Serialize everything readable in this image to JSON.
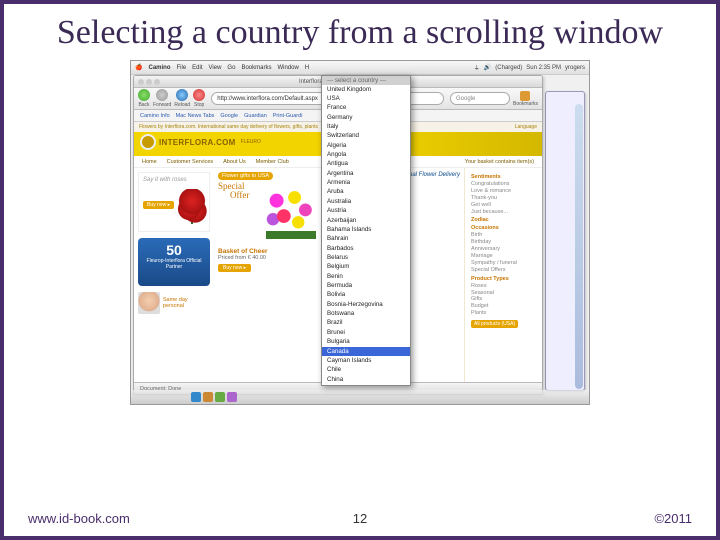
{
  "slide": {
    "title": "Selecting a country from a scrolling window",
    "page_number": "12",
    "footer_url": "www.id-book.com",
    "copyright": "©2011"
  },
  "mac_menubar": {
    "app": "Camino",
    "items": [
      "File",
      "Edit",
      "View",
      "Go",
      "Bookmarks",
      "Window",
      "H"
    ],
    "status_battery": "(Charged)",
    "status_time": "Sun 2:35 PM",
    "status_user": "yrogers"
  },
  "browser": {
    "window_title": "Interflora.com FLOWERS| Int",
    "toolbar": {
      "back": "Back",
      "forward": "Forward",
      "reload": "Reload",
      "stop": "Stop"
    },
    "url": "http://www.interflora.com/Default.aspx",
    "search_placeholder": "Google",
    "bookmarks_btn": "Bookmarks",
    "bookmark_bar": [
      "Camino Info",
      "Mac News Tabs",
      "Google",
      "Guardian",
      "Print-Guardi"
    ],
    "status": "Document: Done"
  },
  "webpage": {
    "tagline": "Flowers by Interflora.com. International same day delivery of flowers, gifts, plants",
    "language_link": "Language",
    "brand": "INTERFLORA.COM",
    "brand_sub": "FLEURO",
    "nav": [
      "Home",
      "Customer Services",
      "About Us",
      "Member Club"
    ],
    "nav_right": "Your basket contains item(s)",
    "intl_delivery": "International Flower Delivery",
    "roses_tag": "Say it with roses",
    "buy_now": "Buy now",
    "flower_gifts": "Flower gifts to USA",
    "special": "Special",
    "offer": "Offer",
    "product_name": "Basket of Cheer",
    "product_price": "Priced from € 40.00",
    "blue50": "50",
    "blue_label": "Fleurop-Interflora Official Partner",
    "personal": "Same day personal",
    "side": {
      "sentiments_h": "Sentiments",
      "sentiments": [
        "Congratulations",
        "Love & romance",
        "Thank-you",
        "Get well",
        "Just because..."
      ],
      "zodiac_h": "Zodiac",
      "occasions_h": "Occasions",
      "occasions": [
        "Birth",
        "Birthday",
        "Anniversary",
        "Marriage",
        "Sympathy / funeral",
        "Special Offers"
      ],
      "ptypes_h": "Product Types",
      "ptypes": [
        "Roses",
        "Seasonal",
        "Gifts",
        "Budget",
        "Plants"
      ],
      "all": "All products (USA)"
    }
  },
  "dropdown": {
    "header": "--- select a country ---",
    "selected": "Canada",
    "options": [
      "United Kingdom",
      "USA",
      "France",
      "Germany",
      "Italy",
      "Switzerland",
      "Algeria",
      "Angola",
      "Antigua",
      "Argentina",
      "Armenia",
      "Aruba",
      "Australia",
      "Austria",
      "Azerbaijan",
      "Bahama Islands",
      "Bahrain",
      "Barbados",
      "Belarus",
      "Belgium",
      "Benin",
      "Bermuda",
      "Bolivia",
      "Bosnia-Herzegovina",
      "Botswana",
      "Brazil",
      "Brunei",
      "Bulgaria",
      "Canada",
      "Cayman Islands",
      "Chile",
      "China"
    ]
  }
}
